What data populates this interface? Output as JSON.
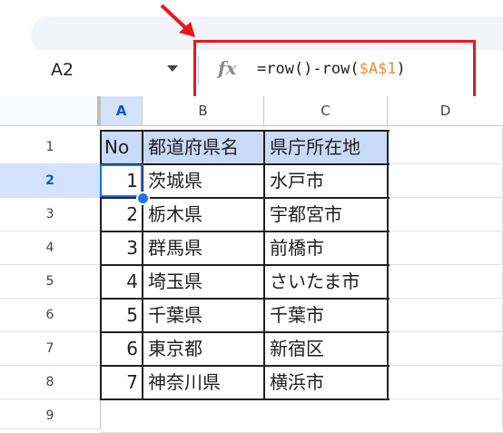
{
  "formula_bar": {
    "name_box": "A2",
    "fx_label": "fx",
    "formula_prefix": "=row()-row(",
    "formula_ref": "$A$1",
    "formula_suffix": ")"
  },
  "columns": [
    "A",
    "B",
    "C",
    "D"
  ],
  "rows": [
    {
      "num": "1",
      "a": "No",
      "b": "都道府県名",
      "c": "県庁所在地"
    },
    {
      "num": "2",
      "a": "1",
      "b": "茨城県",
      "c": "水戸市"
    },
    {
      "num": "3",
      "a": "2",
      "b": "栃木県",
      "c": "宇都宮市"
    },
    {
      "num": "4",
      "a": "3",
      "b": "群馬県",
      "c": "前橋市"
    },
    {
      "num": "5",
      "a": "4",
      "b": "埼玉県",
      "c": "さいたま市"
    },
    {
      "num": "6",
      "a": "5",
      "b": "千葉県",
      "c": "千葉市"
    },
    {
      "num": "7",
      "a": "6",
      "b": "東京都",
      "c": "新宿区"
    },
    {
      "num": "8",
      "a": "7",
      "b": "神奈川県",
      "c": "横浜市"
    }
  ],
  "partial_row_num": "9",
  "colors": {
    "accent": "#1a73e8",
    "highlight_box": "#e8171c",
    "header_fill": "#c9daf8"
  }
}
